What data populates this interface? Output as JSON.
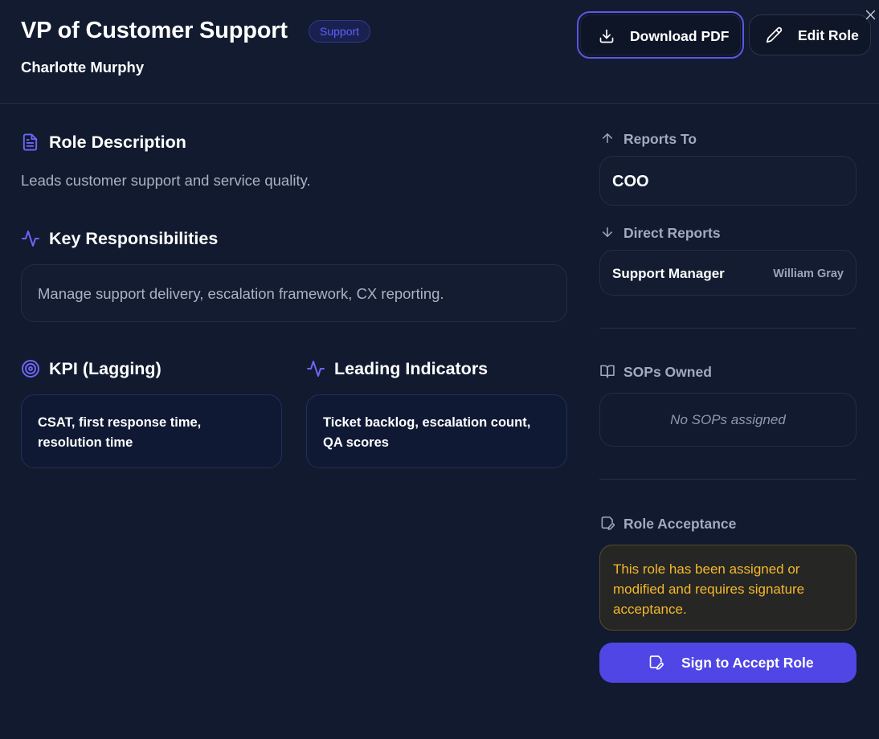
{
  "header": {
    "role_title": "VP of Customer Support",
    "department_badge": "Support",
    "person_name": "Charlotte Murphy",
    "download_label": "Download PDF",
    "edit_label": "Edit Role"
  },
  "main": {
    "description_title": "Role Description",
    "description_text": "Leads customer support and service quality.",
    "responsibilities_title": "Key Responsibilities",
    "responsibilities_text": "Manage support delivery, escalation framework, CX reporting.",
    "kpi_title": "KPI (Lagging)",
    "kpi_text": "CSAT, first response time, resolution time",
    "leading_title": "Leading Indicators",
    "leading_text": "Ticket backlog, escalation count, QA scores"
  },
  "sidebar": {
    "reports_to_label": "Reports To",
    "reports_to_value": "COO",
    "direct_reports_label": "Direct Reports",
    "direct_reports": [
      {
        "role": "Support Manager",
        "person": "William Gray"
      }
    ],
    "sops_label": "SOPs Owned",
    "sops_empty": "No SOPs assigned",
    "acceptance_label": "Role Acceptance",
    "acceptance_notice": "This role has been assigned or modified and requires signature acceptance.",
    "sign_label": "Sign to Accept Role"
  },
  "icons": {
    "download": "download-icon",
    "edit": "pencil-icon",
    "close": "close-icon",
    "description": "document-icon",
    "responsibilities": "activity-icon",
    "kpi": "target-icon",
    "leading": "activity-icon",
    "reports_to": "arrow-up-icon",
    "direct_reports": "arrow-down-icon",
    "sops": "book-icon",
    "acceptance": "signature-icon"
  },
  "colors": {
    "background": "#111a2e",
    "accent": "#4f46e5",
    "badge_text": "#5b63ff",
    "warning_text": "#f5b82e"
  }
}
